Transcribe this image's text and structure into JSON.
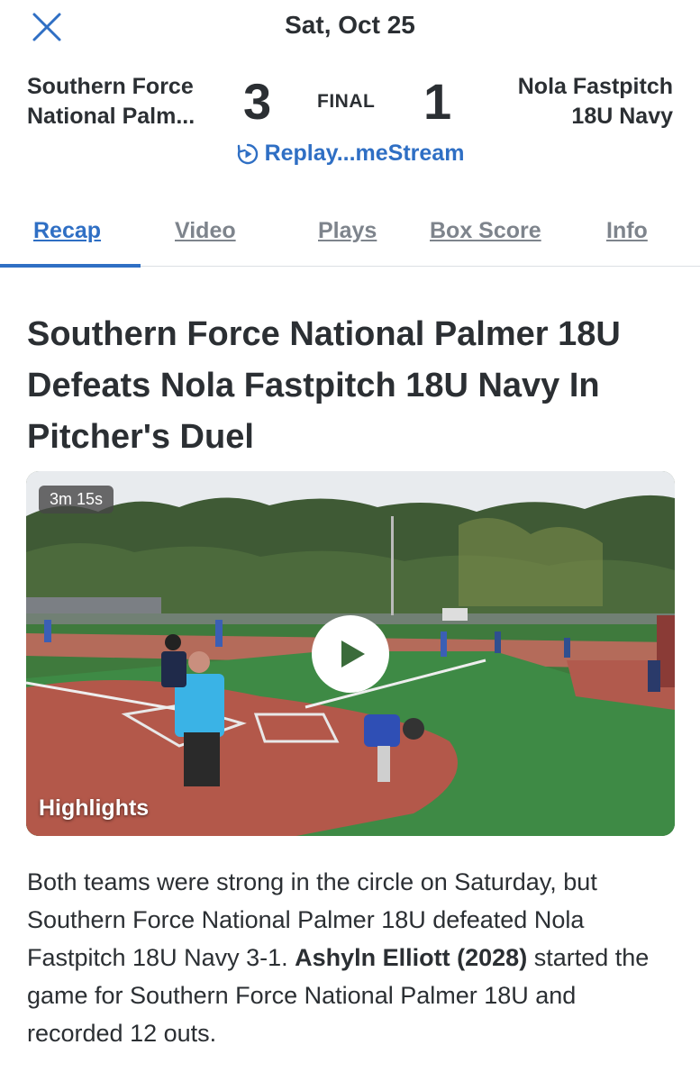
{
  "header": {
    "date": "Sat, Oct 25"
  },
  "game": {
    "home_team_line1": "Southern Force",
    "home_team_line2": "National Palm...",
    "home_score": "3",
    "status": "FINAL",
    "away_score": "1",
    "away_team_line1": "Nola Fastpitch",
    "away_team_line2": "18U Navy",
    "replay_label": "Replay...meStream"
  },
  "tabs": [
    {
      "label": "Recap"
    },
    {
      "label": "Video"
    },
    {
      "label": "Plays"
    },
    {
      "label": "Box Score"
    },
    {
      "label": "Info"
    }
  ],
  "article": {
    "headline": "Southern Force National Palmer 18U Defeats Nola Fastpitch 18U Navy In Pitcher's Duel",
    "video": {
      "duration": "3m 15s",
      "label": "Highlights"
    },
    "body_part1": "Both teams were strong in the circle on Saturday, but Southern Force National Palmer 18U defeated Nola Fastpitch 18U Navy 3-1. ",
    "body_bold": "Ashyln Elliott (2028)",
    "body_part2": " started the game for Southern Force National Palmer 18U and recorded 12 outs."
  },
  "colors": {
    "accent": "#2f6fc4",
    "text": "#2b2f33",
    "tab_inactive": "#7e848c"
  },
  "icons": {
    "close": "close-icon",
    "replay": "replay-icon",
    "play": "play-icon"
  }
}
